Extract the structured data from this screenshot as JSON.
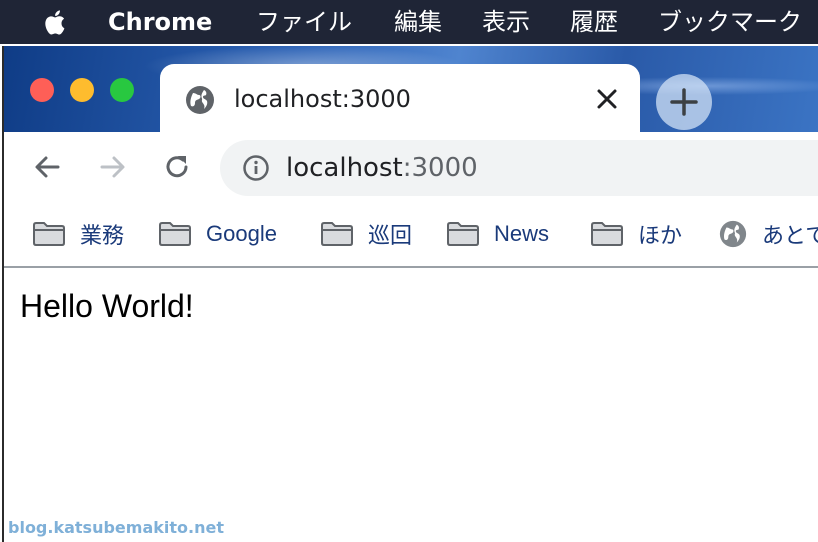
{
  "menubar": {
    "app_name": "Chrome",
    "items": [
      "ファイル",
      "編集",
      "表示",
      "履歴",
      "ブックマーク"
    ]
  },
  "tab": {
    "title": "localhost:3000"
  },
  "omnibox": {
    "host": "localhost",
    "port": ":3000"
  },
  "bookmarks": [
    {
      "label": "業務",
      "icon": "folder-icon"
    },
    {
      "label": "Google",
      "icon": "folder-icon"
    },
    {
      "label": "巡回",
      "icon": "folder-icon"
    },
    {
      "label": "News",
      "icon": "folder-icon"
    },
    {
      "label": "ほか",
      "icon": "folder-icon"
    },
    {
      "label": "あとで",
      "icon": "globe-icon"
    }
  ],
  "page": {
    "text": "Hello World!"
  },
  "watermark": "blog.katsubemakito.net",
  "colors": {
    "menubar": "#1f2536",
    "traffic_red": "#fe5f57",
    "traffic_yellow": "#febc2e",
    "traffic_green": "#28c840",
    "bookmark_text": "#1a3a7a",
    "watermark": "#7fb0d8"
  }
}
